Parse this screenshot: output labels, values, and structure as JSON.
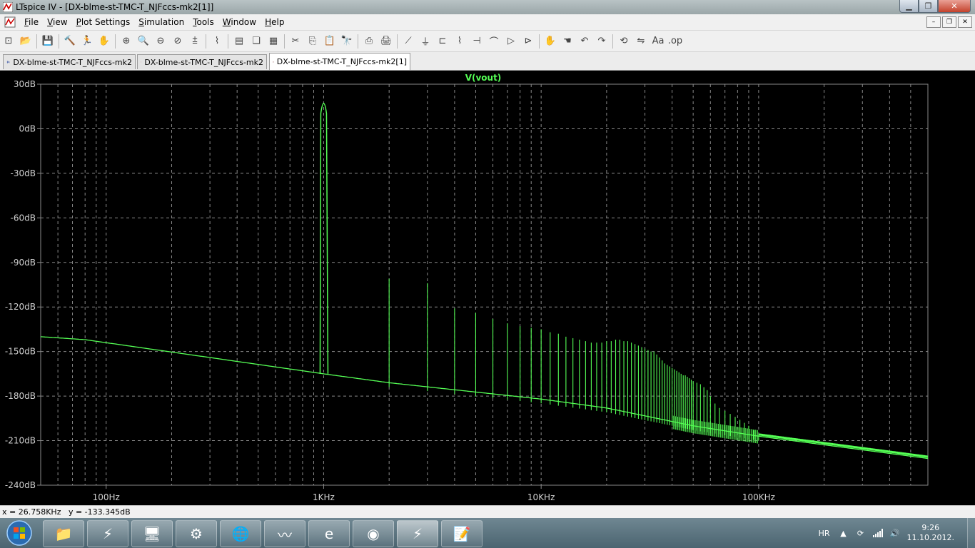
{
  "window": {
    "title": "LTspice IV - [DX-blme-st-TMC-T_NJFccs-mk2[1]]"
  },
  "menu": {
    "items": [
      {
        "label": "File",
        "accel": "F"
      },
      {
        "label": "View",
        "accel": "V"
      },
      {
        "label": "Plot Settings",
        "accel": "P"
      },
      {
        "label": "Simulation",
        "accel": "S"
      },
      {
        "label": "Tools",
        "accel": "T"
      },
      {
        "label": "Window",
        "accel": "W"
      },
      {
        "label": "Help",
        "accel": "H"
      }
    ]
  },
  "toolbar": {
    "icons": [
      "new-schematic-icon",
      "open-icon",
      "save-icon",
      "control-panel-icon",
      "run-icon",
      "pan-icon",
      "zoom-in-icon",
      "zoom-fit-icon",
      "zoom-out-icon",
      "zoom-cancel-icon",
      "autorange-icon",
      "waveform-icon",
      "tile-horizontal-icon",
      "cascade-icon",
      "tile-icon",
      "cut-icon",
      "copy-icon",
      "paste-icon",
      "find-icon",
      "print-preview-icon",
      "print-icon",
      "wire-icon",
      "ground-icon",
      "label-net-icon",
      "resistor-icon",
      "capacitor-icon",
      "inductor-icon",
      "diode-icon",
      "component-icon",
      "move-icon",
      "drag-icon",
      "undo-icon",
      "redo-icon",
      "rotate-icon",
      "mirror-icon",
      "text-icon",
      "spice-directive-icon"
    ]
  },
  "tabs": [
    {
      "label": "DX-blme-st-TMC-T_NJFccs-mk2",
      "kind": "schematic",
      "active": false
    },
    {
      "label": "DX-blme-st-TMC-T_NJFccs-mk2",
      "kind": "waveform",
      "active": false
    },
    {
      "label": "DX-blme-st-TMC-T_NJFccs-mk2[1]",
      "kind": "waveform",
      "active": true
    }
  ],
  "colors": {
    "trace": "#55ff55",
    "grid": "#8a8a8a",
    "axis_text": "#d0d0d0",
    "plot_bg": "#000000"
  },
  "chart_data": {
    "type": "line",
    "title": "V(vout)",
    "xscale": "log",
    "xlim": [
      50,
      600000
    ],
    "ylim": [
      -240,
      30
    ],
    "x_ticks": [
      100,
      1000,
      10000,
      100000
    ],
    "x_tick_labels": [
      "100Hz",
      "1KHz",
      "10KHz",
      "100KHz"
    ],
    "y_ticks": [
      30,
      0,
      -30,
      -60,
      -90,
      -120,
      -150,
      -180,
      -210,
      -240
    ],
    "y_tick_labels": [
      "30dB",
      "0dB",
      "-30dB",
      "-60dB",
      "-90dB",
      "-120dB",
      "-150dB",
      "-180dB",
      "-210dB",
      "-240dB"
    ],
    "grid": true,
    "series": [
      {
        "name": "V(vout)",
        "fundamental": {
          "x": 1000,
          "y": 20
        },
        "floor": [
          [
            50,
            -140
          ],
          [
            80,
            -142
          ],
          [
            1000,
            -165
          ],
          [
            2000,
            -171
          ],
          [
            10000,
            -182
          ],
          [
            20000,
            -188
          ],
          [
            50000,
            -200
          ],
          [
            100000,
            -207
          ],
          [
            600000,
            -222
          ]
        ],
        "harmonic_peaks": [
          [
            2000,
            -101
          ],
          [
            3000,
            -104
          ],
          [
            4000,
            -121
          ],
          [
            5000,
            -124
          ],
          [
            6000,
            -128
          ],
          [
            7000,
            -131
          ],
          [
            8000,
            -133
          ],
          [
            9000,
            -134
          ],
          [
            10000,
            -135
          ],
          [
            11000,
            -137
          ],
          [
            12000,
            -138
          ],
          [
            13000,
            -140
          ],
          [
            14000,
            -141
          ],
          [
            15000,
            -142
          ],
          [
            16000,
            -143
          ],
          [
            17000,
            -144
          ],
          [
            18000,
            -144
          ],
          [
            19000,
            -144
          ],
          [
            20000,
            -143
          ],
          [
            21000,
            -143
          ],
          [
            22000,
            -142
          ],
          [
            23000,
            -142
          ],
          [
            24000,
            -143
          ],
          [
            25000,
            -143
          ],
          [
            26000,
            -144
          ],
          [
            27000,
            -145
          ],
          [
            28000,
            -146
          ],
          [
            29000,
            -147
          ],
          [
            30000,
            -148
          ],
          [
            31000,
            -149
          ],
          [
            32000,
            -150
          ],
          [
            33000,
            -150
          ],
          [
            34000,
            -152
          ],
          [
            35000,
            -154
          ],
          [
            36000,
            -156
          ],
          [
            37000,
            -158
          ],
          [
            38000,
            -159
          ],
          [
            39000,
            -160
          ],
          [
            40000,
            -161
          ],
          [
            41000,
            -162
          ],
          [
            42000,
            -163
          ],
          [
            43000,
            -164
          ],
          [
            44000,
            -165
          ],
          [
            45000,
            -166
          ],
          [
            46000,
            -166
          ],
          [
            47000,
            -167
          ],
          [
            48000,
            -168
          ],
          [
            49000,
            -169
          ],
          [
            50000,
            -170
          ],
          [
            52000,
            -171
          ],
          [
            54000,
            -172
          ],
          [
            56000,
            -174
          ],
          [
            58000,
            -176
          ],
          [
            60000,
            -180
          ],
          [
            63000,
            -185
          ],
          [
            66000,
            -188
          ],
          [
            70000,
            -190
          ],
          [
            74000,
            -192
          ],
          [
            78000,
            -194
          ],
          [
            82000,
            -196
          ],
          [
            86000,
            -198
          ],
          [
            90000,
            -200
          ],
          [
            95000,
            -203
          ],
          [
            100000,
            -206
          ]
        ]
      }
    ]
  },
  "status": {
    "cursor": "x = 26.758KHz   y = -133.345dB"
  },
  "taskbar": {
    "apps": [
      "explorer-icon",
      "winamp-icon",
      "remote-desktop-icon",
      "faucet-icon",
      "browser-icon",
      "oscilloscope-icon",
      "internet-explorer-icon",
      "chrome-icon",
      "ltspice-icon",
      "notepad-icon"
    ],
    "language": "HR",
    "time": "9:26",
    "date": "11.10.2012."
  }
}
